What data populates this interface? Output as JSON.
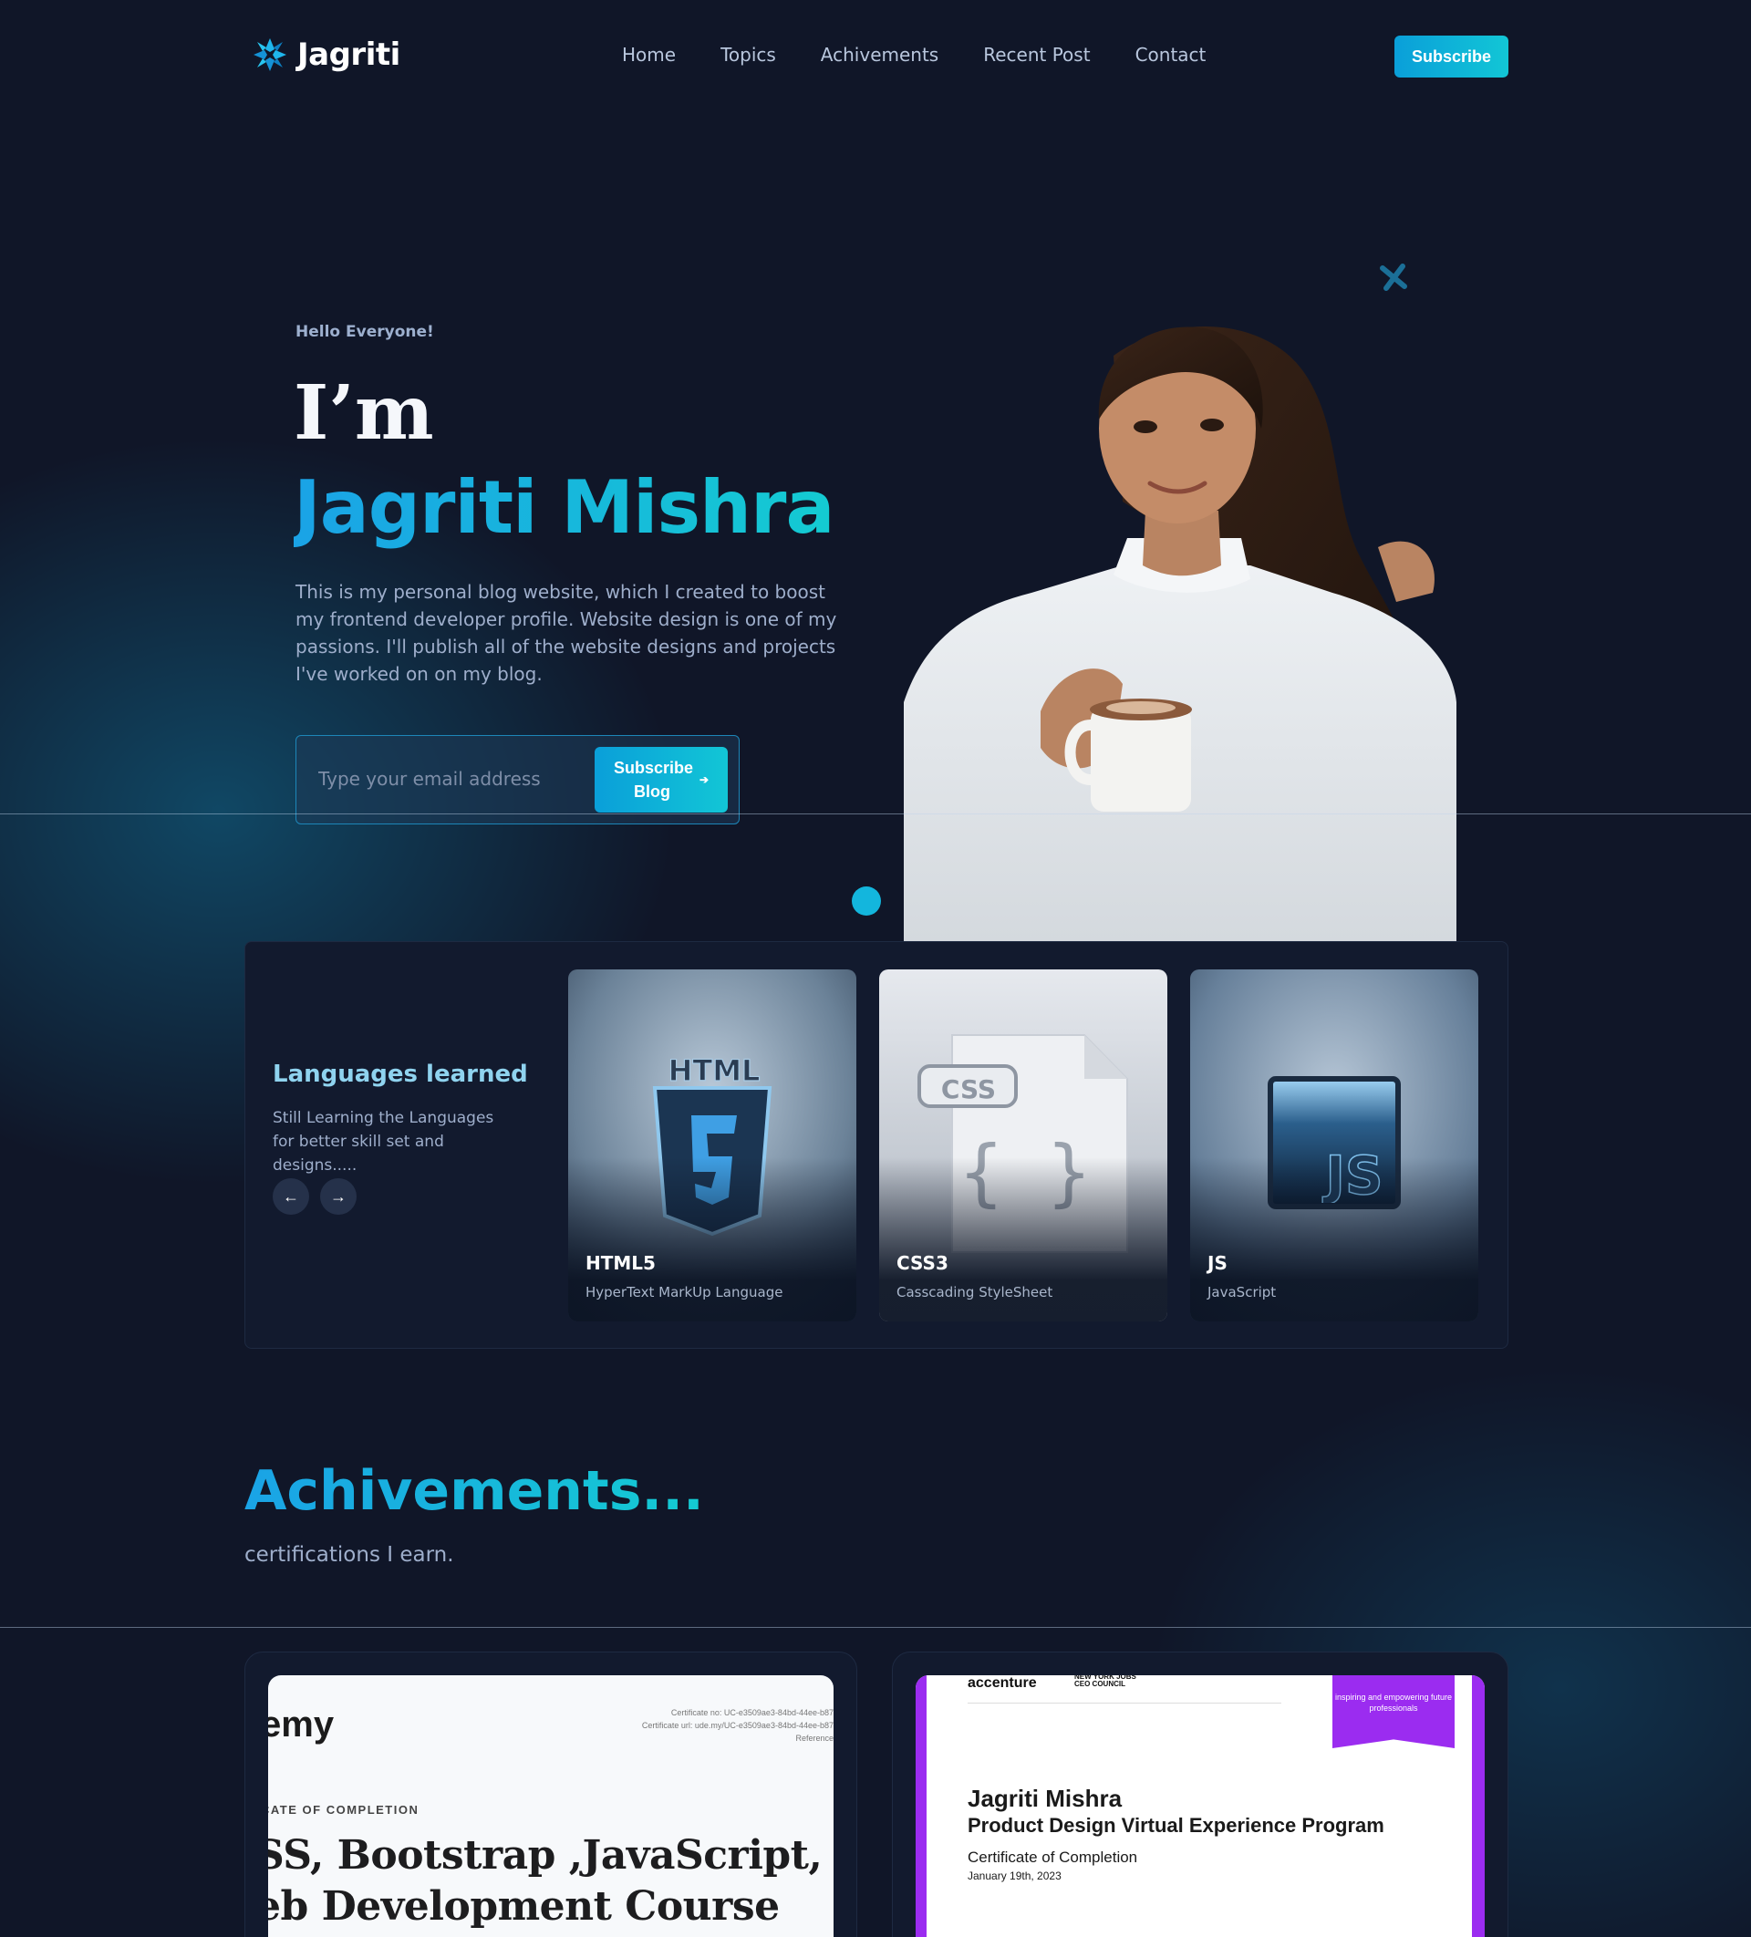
{
  "brand": {
    "name": "Jagriti",
    "accent": "#0fb6dc",
    "background": "#101628"
  },
  "nav": {
    "items": [
      "Home",
      "Topics",
      "Achivements",
      "Recent Post",
      "Contact"
    ],
    "subscribe": "Subscribe"
  },
  "hero": {
    "greeting": "Hello Everyone!",
    "intro": "I’m",
    "name": "Jagriti Mishra",
    "bio": "This is my personal blog website, which I created to boost my frontend developer profile. Website design is one of my passions. I'll publish all of the website designs and projects I've worked on on my blog.",
    "email_placeholder": "Type your email address",
    "cta": "Subscribe Blog"
  },
  "languages": {
    "title": "Languages learned",
    "description": "Still Learning the Languages for better skill set and designs.....",
    "cards": [
      {
        "title": "HTML5",
        "subtitle": "HyperText MarkUp Language",
        "art_text": "HTML"
      },
      {
        "title": "CSS3",
        "subtitle": "Casscading StyleSheet",
        "art_text": "CSS"
      },
      {
        "title": "JS",
        "subtitle": "JavaScript",
        "art_text": "JS"
      }
    ]
  },
  "achievements": {
    "title": "Achivements...",
    "subtitle": "certifications I earn.",
    "certificates": [
      {
        "logo": "emy",
        "meta": [
          "Certificate no: UC-e3509ae3-84bd-44ee-b87",
          "Certificate url: ude.my/UC-e3509ae3-84bd-44ee-b87",
          "Reference"
        ],
        "kicker": "CATE OF COMPLETION",
        "course_line1": "SS, Bootstrap ,JavaScript,",
        "course_line2": "eb Development Course"
      },
      {
        "logo": "accenture",
        "partner": "NEW YORK JOBS CEO COUNCIL",
        "ribbon": "inspiring and empowering future professionals",
        "name": "Jagriti Mishra",
        "program": "Product Design Virtual Experience Program",
        "type": "Certificate of Completion",
        "date": "January 19th, 2023"
      }
    ]
  }
}
